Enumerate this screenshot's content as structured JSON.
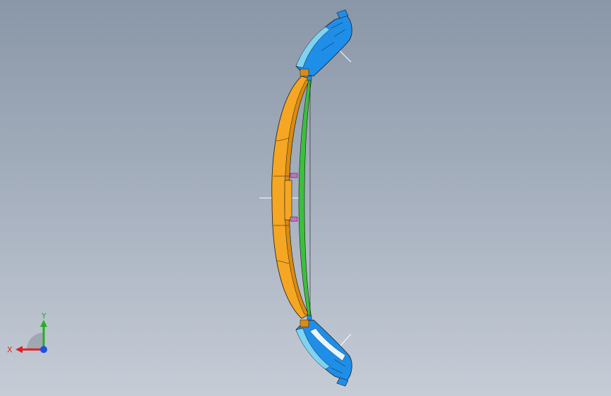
{
  "viewport": {
    "background_top": "#8a97a8",
    "background_bottom": "#c6ccd6"
  },
  "model": {
    "colors": {
      "main_body": "#f5a623",
      "main_body_shade": "#d98b12",
      "end_caps": "#1e8ee8",
      "end_caps_light": "#7fd3f2",
      "inner_rib": "#3cbf3c",
      "clips": "#c86ec8",
      "edges": "#1a1a1a"
    }
  },
  "triad": {
    "x_label": "X",
    "y_label": "Y",
    "x_color": "#e02020",
    "y_color": "#22b022",
    "z_color": "#2050e0"
  }
}
